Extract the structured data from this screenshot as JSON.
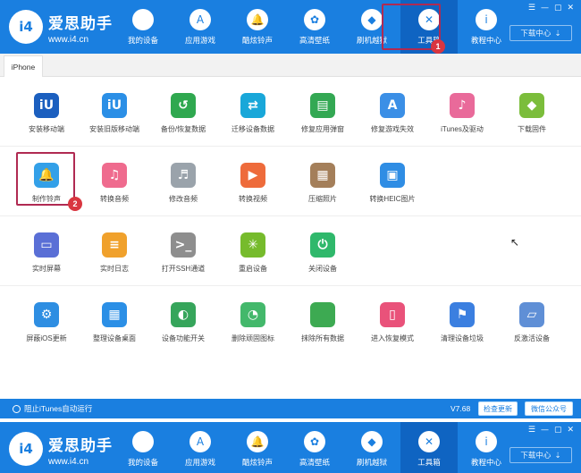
{
  "app": {
    "name": "爱思助手",
    "url": "www.i4.cn",
    "logo_text": "i4"
  },
  "nav": [
    {
      "label": "我的设备",
      "icon": "apple-icon",
      "glyph": ""
    },
    {
      "label": "应用游戏",
      "icon": "appstore-icon",
      "glyph": "A"
    },
    {
      "label": "酷炫铃声",
      "icon": "bell-icon",
      "glyph": "🔔"
    },
    {
      "label": "高清壁纸",
      "icon": "flower-icon",
      "glyph": "✿"
    },
    {
      "label": "刷机越狱",
      "icon": "dropbox-icon",
      "glyph": "◆"
    },
    {
      "label": "工具箱",
      "icon": "tools-icon",
      "glyph": "✕"
    },
    {
      "label": "教程中心",
      "icon": "info-icon",
      "glyph": "i"
    }
  ],
  "window_controls": [
    "☰",
    "—",
    "▢",
    "✕"
  ],
  "download_label": "下载中心",
  "download_glyph": "⇣",
  "badges": {
    "one": "1",
    "two": "2"
  },
  "tab_label": "iPhone",
  "tools": [
    [
      {
        "label": "安装移动端",
        "icon": "i4-icon",
        "color": "#1b5fbf",
        "glyph": "iU"
      },
      {
        "label": "安装旧版移动端",
        "icon": "i4-old-icon",
        "color": "#2b8fe6",
        "glyph": "iU"
      },
      {
        "label": "备份/恢复数据",
        "icon": "backup-icon",
        "color": "#2fa84f",
        "glyph": "↺"
      },
      {
        "label": "迁移设备数据",
        "icon": "migrate-icon",
        "color": "#19a7d9",
        "glyph": "⇄"
      },
      {
        "label": "修复应用弹窗",
        "icon": "repair-popup-icon",
        "color": "#33a853",
        "glyph": "▤"
      },
      {
        "label": "修复游戏失效",
        "icon": "repair-game-icon",
        "color": "#3b8fe6",
        "glyph": "A"
      },
      {
        "label": "iTunes及驱动",
        "icon": "itunes-icon",
        "color": "#e96a9a",
        "glyph": "♪"
      },
      {
        "label": "下载固件",
        "icon": "firmware-icon",
        "color": "#7bbd3b",
        "glyph": "◆"
      }
    ],
    [
      {
        "label": "制作铃声",
        "icon": "ringtone-icon",
        "color": "#33a0e8",
        "glyph": "🔔"
      },
      {
        "label": "转换音频",
        "icon": "convert-audio-icon",
        "color": "#ef6b8e",
        "glyph": "♫"
      },
      {
        "label": "修改音频",
        "icon": "edit-audio-icon",
        "color": "#9aa3ab",
        "glyph": "♬"
      },
      {
        "label": "转换视频",
        "icon": "convert-video-icon",
        "color": "#ee6b3b",
        "glyph": "▶"
      },
      {
        "label": "压缩照片",
        "icon": "compress-photo-icon",
        "color": "#a47f5a",
        "glyph": "▦"
      },
      {
        "label": "转换HEIC图片",
        "icon": "heic-icon",
        "color": "#2f8de4",
        "glyph": "▣"
      }
    ],
    [
      {
        "label": "实时屏幕",
        "icon": "screen-icon",
        "color": "#5a6fd6",
        "glyph": "▭"
      },
      {
        "label": "实时日志",
        "icon": "log-icon",
        "color": "#f0a12c",
        "glyph": "≡"
      },
      {
        "label": "打开SSH通道",
        "icon": "ssh-icon",
        "color": "#8e8e8e",
        "glyph": ">_"
      },
      {
        "label": "重启设备",
        "icon": "restart-icon",
        "color": "#76bb2c",
        "glyph": "✳"
      },
      {
        "label": "关闭设备",
        "icon": "power-icon",
        "color": "#2fb86b",
        "glyph": "⏻"
      }
    ],
    [
      {
        "label": "屏蔽iOS更新",
        "icon": "block-update-icon",
        "color": "#2e8ee2",
        "glyph": "⚙"
      },
      {
        "label": "整理设备桌面",
        "icon": "desktop-icon",
        "color": "#2b8fe6",
        "glyph": "▦"
      },
      {
        "label": "设备功能开关",
        "icon": "switch-icon",
        "color": "#36a55b",
        "glyph": "◐"
      },
      {
        "label": "删除顽固图标",
        "icon": "delete-icon-icon",
        "color": "#43b86b",
        "glyph": "◔"
      },
      {
        "label": "抹除所有数据",
        "icon": "erase-icon",
        "color": "#3daa52",
        "glyph": ""
      },
      {
        "label": "进入恢复模式",
        "icon": "recovery-icon",
        "color": "#e9527a",
        "glyph": "▯"
      },
      {
        "label": "清理设备垃圾",
        "icon": "clean-icon",
        "color": "#3b7fe0",
        "glyph": "⚑"
      },
      {
        "label": "反激活设备",
        "icon": "deactivate-icon",
        "color": "#5f8fd6",
        "glyph": "▱"
      }
    ]
  ],
  "cursor_glyph": "↖",
  "status": {
    "itunes_toggle": "阻止iTunes自动运行",
    "version": "V7.68",
    "check_update": "检查更新",
    "wechat": "微信公众号"
  }
}
